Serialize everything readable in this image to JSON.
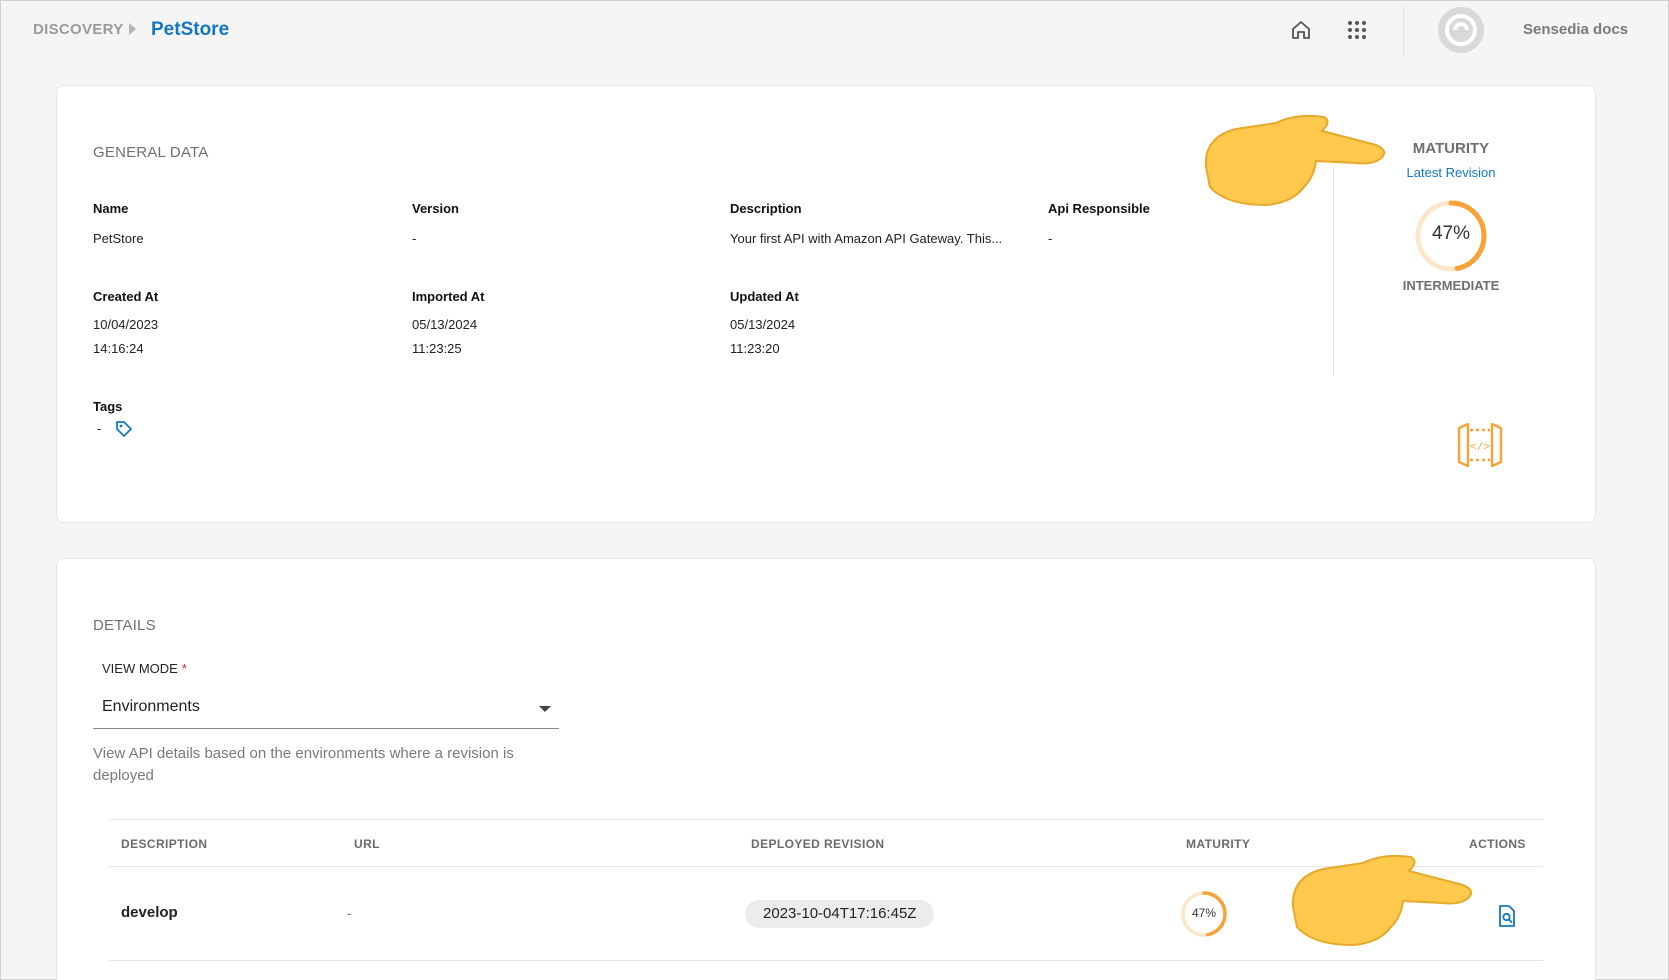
{
  "breadcrumb": {
    "root": "DISCOVERY",
    "current": "PetStore"
  },
  "topbar": {
    "user_label": "Sensedia docs",
    "home_icon": "home-icon",
    "apps_icon": "apps-grid-icon",
    "avatar_icon": "sensedia-logo-icon"
  },
  "general": {
    "title": "GENERAL DATA",
    "fields": {
      "name": {
        "label": "Name",
        "value": "PetStore"
      },
      "version": {
        "label": "Version",
        "value": "-"
      },
      "description": {
        "label": "Description",
        "value": "Your first API with Amazon API Gateway. This..."
      },
      "api_responsible": {
        "label": "Api Responsible",
        "value": "-"
      },
      "created_at": {
        "label": "Created At",
        "date": "10/04/2023",
        "time": "14:16:24"
      },
      "imported_at": {
        "label": "Imported At",
        "date": "05/13/2024",
        "time": "11:23:25"
      },
      "updated_at": {
        "label": "Updated At",
        "date": "05/13/2024",
        "time": "11:23:20"
      },
      "tags": {
        "label": "Tags",
        "value": "-",
        "icon": "tag-icon"
      }
    },
    "maturity": {
      "title": "MATURITY",
      "link": "Latest Revision",
      "percent_label": "47%",
      "percent": 47,
      "level": "INTERMEDIATE",
      "gateway_icon": "api-gateway-icon"
    }
  },
  "details": {
    "title": "DETAILS",
    "view_mode": {
      "label": "VIEW MODE",
      "required_mark": "*",
      "value": "Environments",
      "help": "View API details based on the environments where a revision is deployed"
    },
    "table": {
      "headers": [
        "DESCRIPTION",
        "URL",
        "DEPLOYED REVISION",
        "MATURITY",
        "ACTIONS"
      ],
      "rows": [
        {
          "description": "develop",
          "url": "-",
          "deployed_revision": "2023-10-04T17:16:45Z",
          "maturity_label": "47%",
          "maturity": 47,
          "action_icon": "view-details-icon"
        }
      ]
    }
  },
  "colors": {
    "accent": "#1577c4",
    "maturity_orange": "#f7a33a",
    "maturity_track": "#fde7cc",
    "pointer": "#ffc94d"
  }
}
